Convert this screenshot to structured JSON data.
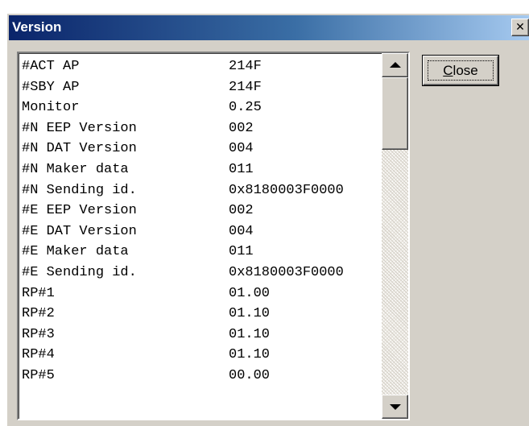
{
  "window": {
    "title": "Version",
    "close_glyph": "✕"
  },
  "close_button": {
    "label": "Close"
  },
  "list": {
    "rows": [
      {
        "key": "#ACT AP",
        "value": "214F"
      },
      {
        "key": "#SBY AP",
        "value": "214F"
      },
      {
        "key": "Monitor",
        "value": "0.25"
      },
      {
        "key": "#N EEP Version",
        "value": "002"
      },
      {
        "key": "#N DAT Version",
        "value": "004"
      },
      {
        "key": "#N Maker data",
        "value": "011"
      },
      {
        "key": "#N Sending id.",
        "value": "0x8180003F0000"
      },
      {
        "key": "#E EEP Version",
        "value": "002"
      },
      {
        "key": "#E DAT Version",
        "value": "004"
      },
      {
        "key": "#E Maker data",
        "value": "011"
      },
      {
        "key": "#E Sending id.",
        "value": "0x8180003F0000"
      },
      {
        "key": "RP#1",
        "value": "01.00"
      },
      {
        "key": "RP#2",
        "value": "01.10"
      },
      {
        "key": "RP#3",
        "value": "01.10"
      },
      {
        "key": "RP#4",
        "value": "01.10"
      },
      {
        "key": "RP#5",
        "value": "00.00"
      }
    ]
  },
  "icons": {
    "window_close": "close-icon",
    "scroll_up": "arrow-up-icon",
    "scroll_down": "arrow-down-icon"
  },
  "colors": {
    "titlebar_start": "#0a246a",
    "titlebar_end": "#a6caf0",
    "face": "#d4d0c8"
  }
}
